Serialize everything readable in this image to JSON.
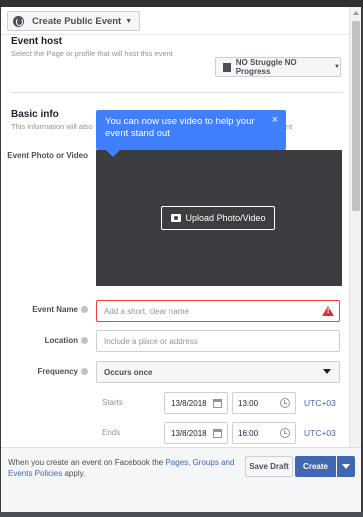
{
  "header": {
    "event_type": "Create Public Event"
  },
  "event_host": {
    "title": "Event host",
    "subtitle": "Select the Page or profile that will host this event",
    "selected_host": "NO Struggle NO Progress"
  },
  "basic_info": {
    "title": "Basic info",
    "subtitle": "This information will also",
    "subtitle_tail": "nt"
  },
  "tooltip": {
    "text": "You can now use video to help your event stand out",
    "close_glyph": "×"
  },
  "form": {
    "photo_label": "Event Photo or Video",
    "upload_label": "Upload Photo/Video",
    "name_label": "Event Name",
    "name_placeholder": "Add a short, clear name",
    "location_label": "Location",
    "location_placeholder": "Include a place or address",
    "frequency_label": "Frequency",
    "frequency_value": "Occurs once",
    "starts_label": "Starts",
    "start_date": "13/8/2018",
    "start_time": "13:00",
    "ends_label": "Ends",
    "end_date": "13/8/2018",
    "end_time": "16:00",
    "timezone": "UTC+03"
  },
  "footer": {
    "text_prefix": "When you create an event on Facebook the",
    "link_text": "Pages, Groups and Events Policies",
    "text_suffix": "apply.",
    "save_draft_label": "Save Draft",
    "create_label": "Create"
  },
  "colors": {
    "accent": "#4267b2",
    "tooltip": "#4080ff",
    "error": "#fa3e3e",
    "photo_bg": "#3b3d40"
  }
}
